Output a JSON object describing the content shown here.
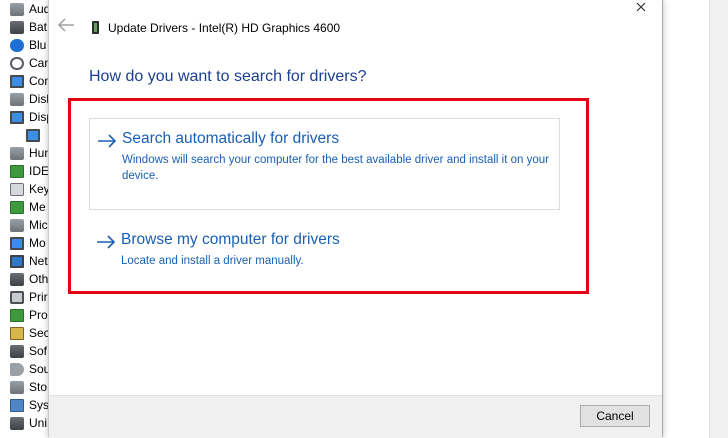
{
  "background_tree": {
    "items": [
      {
        "label": "Aud",
        "icon": "audio-icon"
      },
      {
        "label": "Bat",
        "icon": "battery-icon"
      },
      {
        "label": "Blu",
        "icon": "bluetooth-icon"
      },
      {
        "label": "Can",
        "icon": "camera-icon"
      },
      {
        "label": "Con",
        "icon": "computer-icon"
      },
      {
        "label": "Disk",
        "icon": "disk-drive-icon"
      },
      {
        "label": "Disp",
        "icon": "display-adapter-icon"
      },
      {
        "label": "",
        "icon": "monitor-icon"
      },
      {
        "label": "Hun",
        "icon": "human-interface-icon"
      },
      {
        "label": "IDE",
        "icon": "ide-controller-icon"
      },
      {
        "label": "Key",
        "icon": "keyboard-icon"
      },
      {
        "label": "Me",
        "icon": "memory-icon"
      },
      {
        "label": "Mic",
        "icon": "mice-icon"
      },
      {
        "label": "Mo",
        "icon": "monitors-icon"
      },
      {
        "label": "Net",
        "icon": "network-adapter-icon"
      },
      {
        "label": "Oth",
        "icon": "other-devices-icon"
      },
      {
        "label": "Prir",
        "icon": "print-queue-icon"
      },
      {
        "label": "Pro",
        "icon": "processor-icon"
      },
      {
        "label": "Sec",
        "icon": "security-device-icon"
      },
      {
        "label": "Sof",
        "icon": "software-device-icon"
      },
      {
        "label": "Sou",
        "icon": "sound-icon"
      },
      {
        "label": "Sto",
        "icon": "storage-controller-icon"
      },
      {
        "label": "Sys",
        "icon": "system-devices-icon"
      },
      {
        "label": "Uni",
        "icon": "usb-controller-icon"
      }
    ]
  },
  "dialog": {
    "title": "Update Drivers - Intel(R) HD Graphics 4600",
    "question": "How do you want to search for drivers?",
    "options": [
      {
        "title": "Search automatically for drivers",
        "description": "Windows will search your computer for the best available driver and install it on your device."
      },
      {
        "title": "Browse my computer for drivers",
        "description": "Locate and install a driver manually."
      }
    ],
    "cancel_label": "Cancel"
  },
  "colors": {
    "link_blue": "#1a5fb4",
    "heading_blue": "#1b3f8f",
    "highlight_red": "#e60012"
  }
}
